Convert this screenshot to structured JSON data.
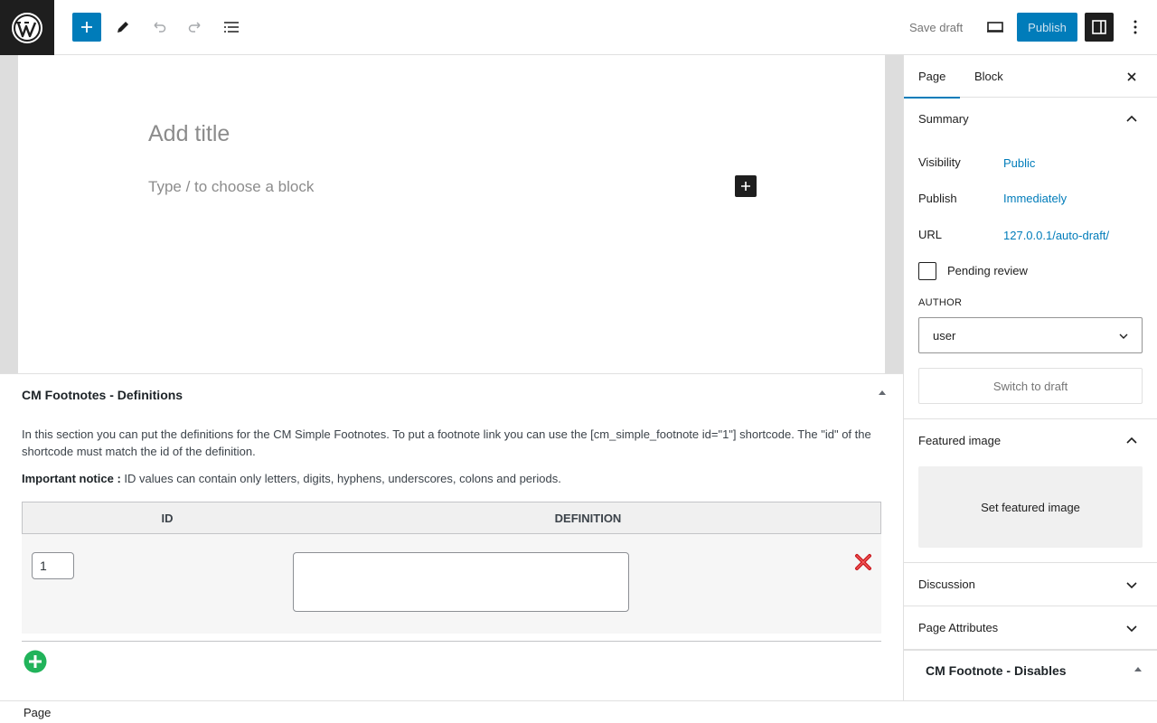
{
  "toolbar": {
    "save_draft": "Save draft",
    "publish": "Publish"
  },
  "editor": {
    "title_placeholder": "Add title",
    "block_placeholder": "Type / to choose a block"
  },
  "footnotes_metabox": {
    "title": "CM Footnotes - Definitions",
    "description": "In this section you can put the definitions for the CM Simple Footnotes. To put a footnote link you can use the [cm_simple_footnote id=\"1\"] shortcode. The \"id\" of the shortcode must match the id of the definition.",
    "notice_label": "Important notice :",
    "notice_text": " ID values can contain only letters, digits, hyphens, underscores, colons and periods.",
    "columns": [
      "ID",
      "DEFINITION"
    ],
    "rows": [
      {
        "id": "1",
        "definition": ""
      }
    ]
  },
  "footer": {
    "breadcrumb": "Page"
  },
  "sidebar": {
    "tabs": [
      "Page",
      "Block"
    ],
    "summary": {
      "title": "Summary",
      "visibility_label": "Visibility",
      "visibility_value": "Public",
      "publish_label": "Publish",
      "publish_value": "Immediately",
      "url_label": "URL",
      "url_value": "127.0.0.1/auto-draft/",
      "pending_review": "Pending review",
      "author_label": "AUTHOR",
      "author_value": "user",
      "switch_to_draft": "Switch to draft"
    },
    "featured_image": {
      "title": "Featured image",
      "set_label": "Set featured image"
    },
    "discussion": "Discussion",
    "page_attributes": "Page Attributes",
    "cm_disables": "CM Footnote - Disables"
  },
  "colors": {
    "accent": "#007cba",
    "dark": "#1e1e1e"
  }
}
